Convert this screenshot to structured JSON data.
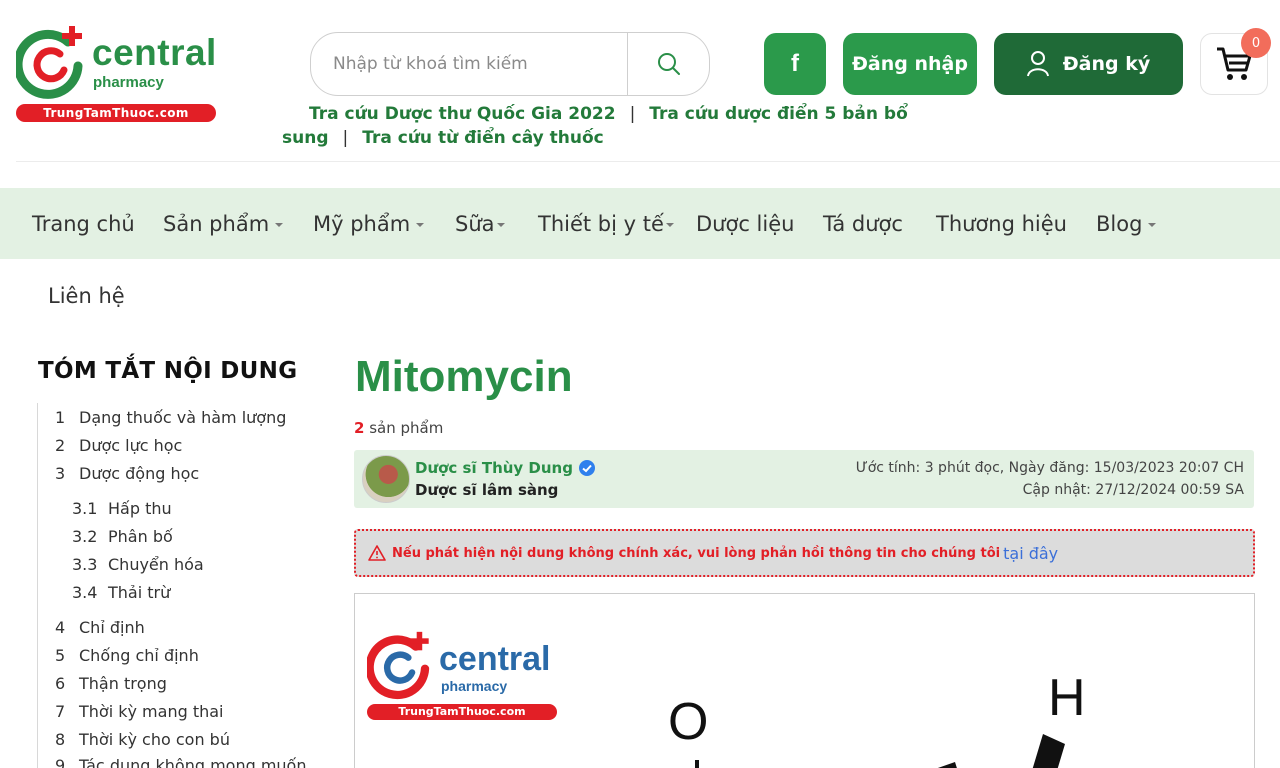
{
  "header": {
    "logo": {
      "brand": "central",
      "sub": "pharmacy",
      "tagline": "TrungTamThuoc.com"
    },
    "search": {
      "placeholder": "Nhập từ khoá tìm kiếm"
    },
    "facebook_label": "f",
    "login_label": "Đăng nhập",
    "register_label": "Đăng ký",
    "cart_count": "0",
    "quick_links": {
      "link1": "Tra cứu Dược thư Quốc Gia 2022",
      "link2": "Tra cứu dược điển 5 bản bổ sung",
      "link3": "Tra cứu từ điển cây thuốc",
      "separator": "|"
    }
  },
  "nav": {
    "items": [
      {
        "label": "Trang chủ",
        "dropdown": false
      },
      {
        "label": "Sản phẩm",
        "dropdown": true
      },
      {
        "label": "Mỹ phẩm",
        "dropdown": true
      },
      {
        "label": "Sữa",
        "dropdown": true
      },
      {
        "label": "Thiết bị y tế",
        "dropdown": true
      },
      {
        "label": "Dược liệu",
        "dropdown": false
      },
      {
        "label": "Tá dược",
        "dropdown": false
      },
      {
        "label": "Thương hiệu",
        "dropdown": false
      },
      {
        "label": "Blog",
        "dropdown": true
      }
    ],
    "contact": "Liên hệ"
  },
  "toc": {
    "title": "TÓM TẮT NỘI DUNG",
    "items": [
      {
        "num": "1",
        "label": "Dạng thuốc và hàm lượng"
      },
      {
        "num": "2",
        "label": "Dược lực học"
      },
      {
        "num": "3",
        "label": "Dược động học"
      },
      {
        "num": "3.1",
        "label": "Hấp thu"
      },
      {
        "num": "3.2",
        "label": "Phân bố"
      },
      {
        "num": "3.3",
        "label": "Chuyển hóa"
      },
      {
        "num": "3.4",
        "label": "Thải trừ"
      },
      {
        "num": "4",
        "label": "Chỉ định"
      },
      {
        "num": "5",
        "label": "Chống chỉ định"
      },
      {
        "num": "6",
        "label": "Thận trọng"
      },
      {
        "num": "7",
        "label": "Thời kỳ mang thai"
      },
      {
        "num": "8",
        "label": "Thời kỳ cho con bú"
      },
      {
        "num": "9",
        "label": "Tác dụng không mong muốn"
      }
    ]
  },
  "article": {
    "title": "Mitomycin",
    "product_count": "2",
    "product_label": "sản phẩm",
    "author": {
      "name": "Dược sĩ Thùy Dung",
      "role": "Dược sĩ lâm sàng",
      "read_info": "Ước tính: 3 phút đọc, Ngày đăng: 15/03/2023 20:07 CH",
      "updated": "Cập nhật: 27/12/2024 00:59 SA"
    },
    "notice": {
      "text": "Nếu phát hiện nội dung không chính xác, vui lòng phản hồi thông tin cho chúng tôi",
      "link": "tại đây"
    },
    "figure": {
      "logo": {
        "brand": "central",
        "sub": "pharmacy",
        "tagline": "TrungTamThuoc.com"
      },
      "atoms": {
        "o": "O",
        "h": "H"
      }
    }
  },
  "colors": {
    "brand_green": "#2a8f48",
    "dark_green": "#1f6a37",
    "nav_bg": "#e3f1e3",
    "brand_red": "#e21f26"
  }
}
